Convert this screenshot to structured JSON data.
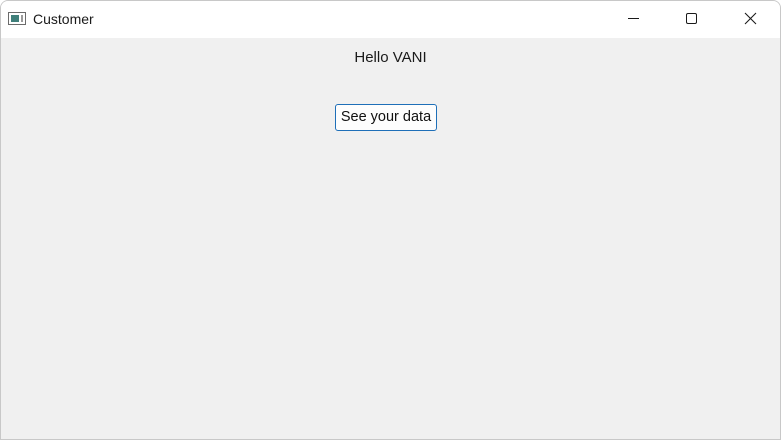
{
  "window": {
    "title": "Customer",
    "app_icon": "window-app-icon",
    "controls": {
      "minimize_icon": "minimize-icon",
      "maximize_icon": "maximize-icon",
      "close_icon": "close-icon"
    }
  },
  "content": {
    "greeting": "Hello VANI",
    "data_button_label": "See your data"
  },
  "colors": {
    "background": "#f0f0f0",
    "titlebar": "#ffffff",
    "button_border": "#1e6fb8"
  }
}
